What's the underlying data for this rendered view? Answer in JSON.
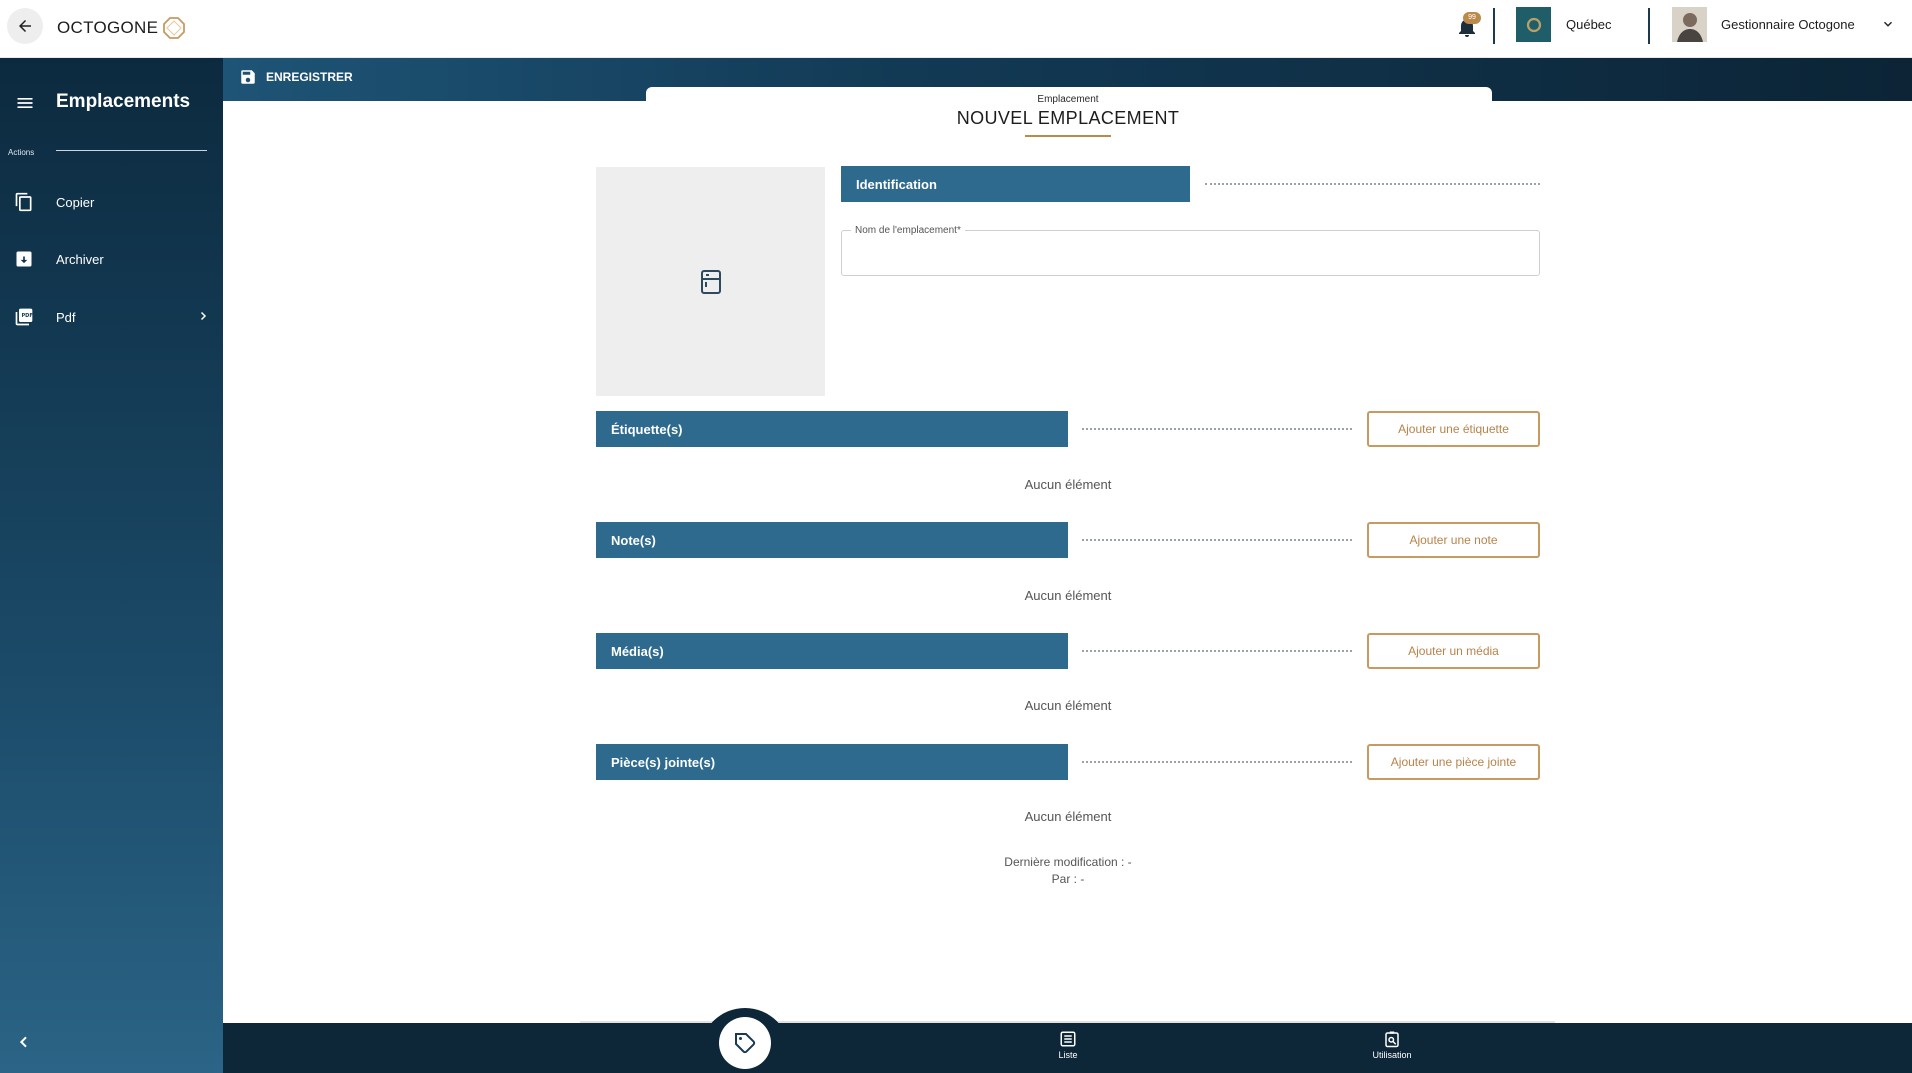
{
  "topbar": {
    "brand": "OCTOGONE",
    "notification_count": "99",
    "org_name": "Québec",
    "user_name": "Gestionnaire Octogone"
  },
  "sidebar": {
    "title": "Emplacements",
    "actions_label": "Actions",
    "items": [
      {
        "label": "Copier",
        "icon": "copy-icon"
      },
      {
        "label": "Archiver",
        "icon": "archive-icon"
      },
      {
        "label": "Pdf",
        "icon": "pdf-icon"
      }
    ]
  },
  "toolbar": {
    "save_label": "ENREGISTRER"
  },
  "page": {
    "subtitle": "Emplacement",
    "title": "NOUVEL EMPLACEMENT"
  },
  "identification": {
    "section_label": "Identification",
    "name_field_label": "Nom de l'emplacement*",
    "name_field_value": ""
  },
  "sections": [
    {
      "label": "Étiquette(s)",
      "button": "Ajouter une étiquette",
      "empty": "Aucun élément"
    },
    {
      "label": "Note(s)",
      "button": "Ajouter une note",
      "empty": "Aucun élément"
    },
    {
      "label": "Média(s)",
      "button": "Ajouter un média",
      "empty": "Aucun élément"
    },
    {
      "label": "Pièce(s) jointe(s)",
      "button": "Ajouter une pièce jointe",
      "empty": "Aucun élément"
    }
  ],
  "meta": {
    "last_modified": "Dernière modification :  -",
    "by": "Par :  -"
  },
  "bottombar": {
    "list_label": "Liste",
    "usage_label": "Utilisation"
  },
  "colors": {
    "sidebar_dark": "#0c2a3f",
    "section_bar": "#2d6a8e",
    "accent": "#b98a4a"
  }
}
